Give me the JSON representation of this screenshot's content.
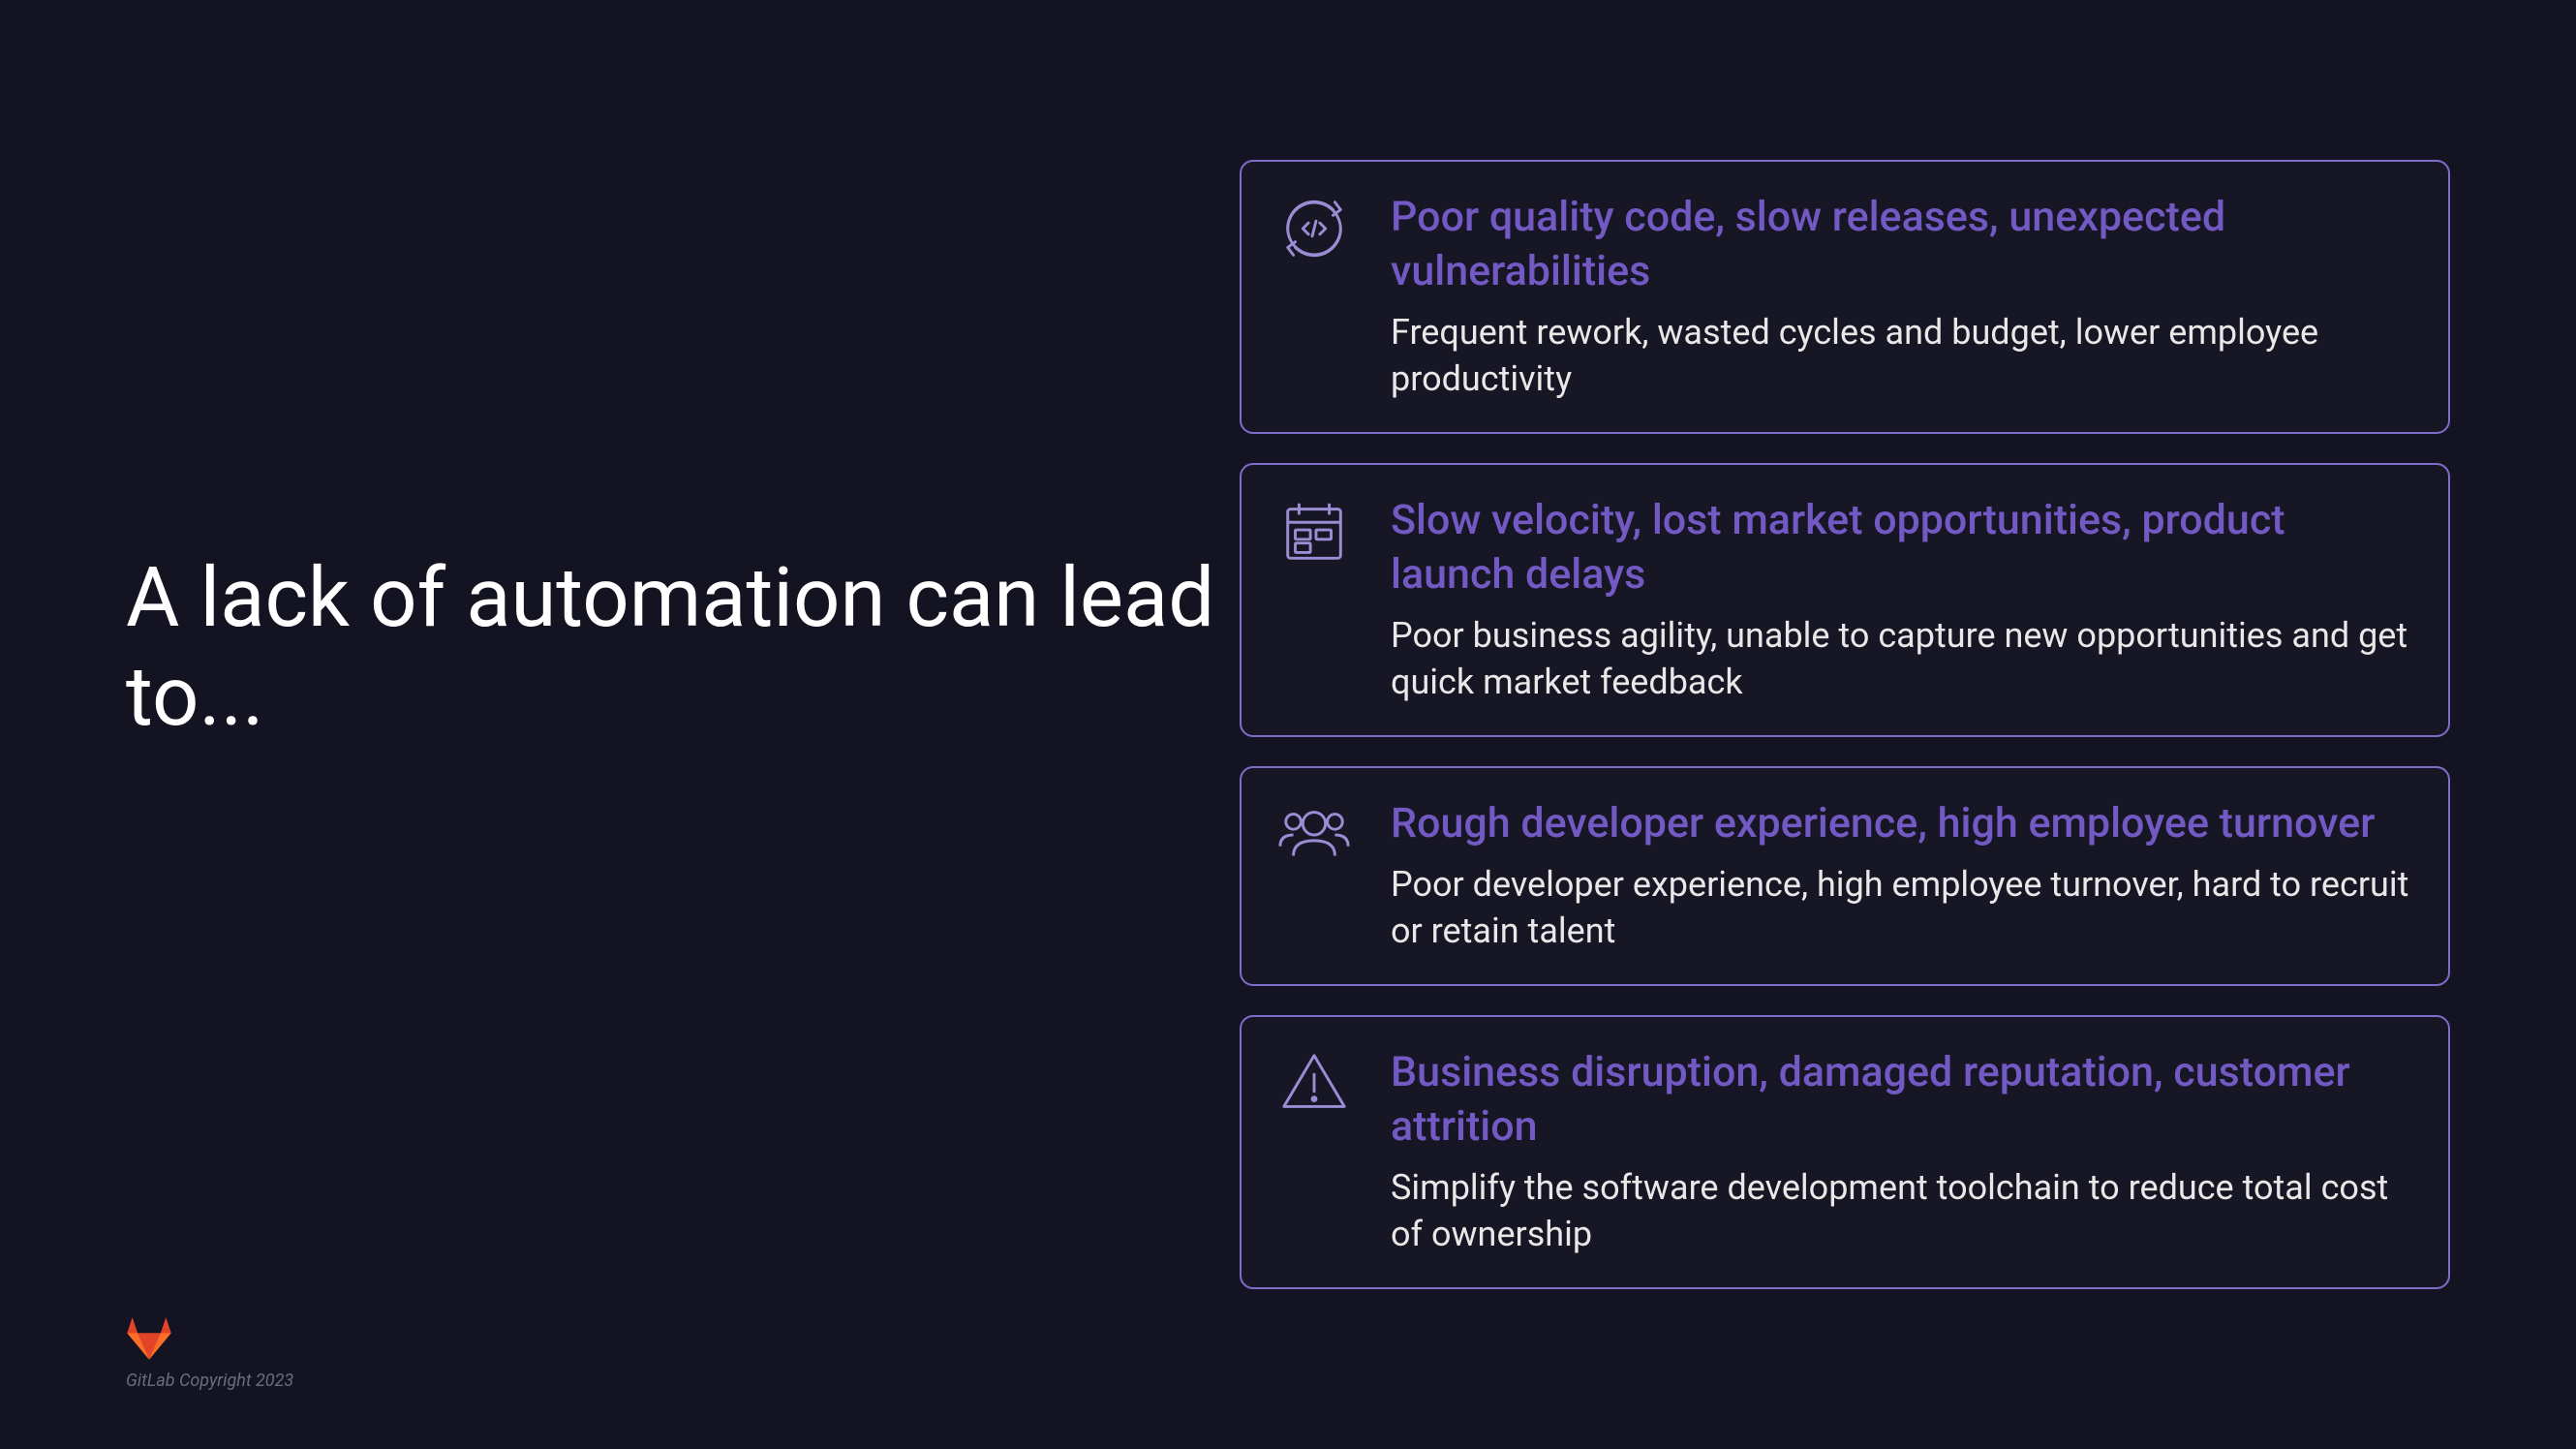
{
  "title": "A lack of automation can lead to...",
  "copyright": "GitLab Copyright 2023",
  "cards": [
    {
      "title": "Poor quality code, slow releases, unexpected vulnerabilities",
      "description": "Frequent rework, wasted cycles and budget, lower employee productivity"
    },
    {
      "title": "Slow velocity, lost market opportunities, product launch delays",
      "description": "Poor business agility, unable to capture new opportunities and get quick market feedback"
    },
    {
      "title": "Rough developer experience, high employee turnover",
      "description": "Poor developer experience, high employee turnover, hard to recruit or retain talent"
    },
    {
      "title": "Business disruption, damaged reputation, customer attrition",
      "description": "Simplify the software development toolchain to reduce total cost of ownership"
    }
  ]
}
